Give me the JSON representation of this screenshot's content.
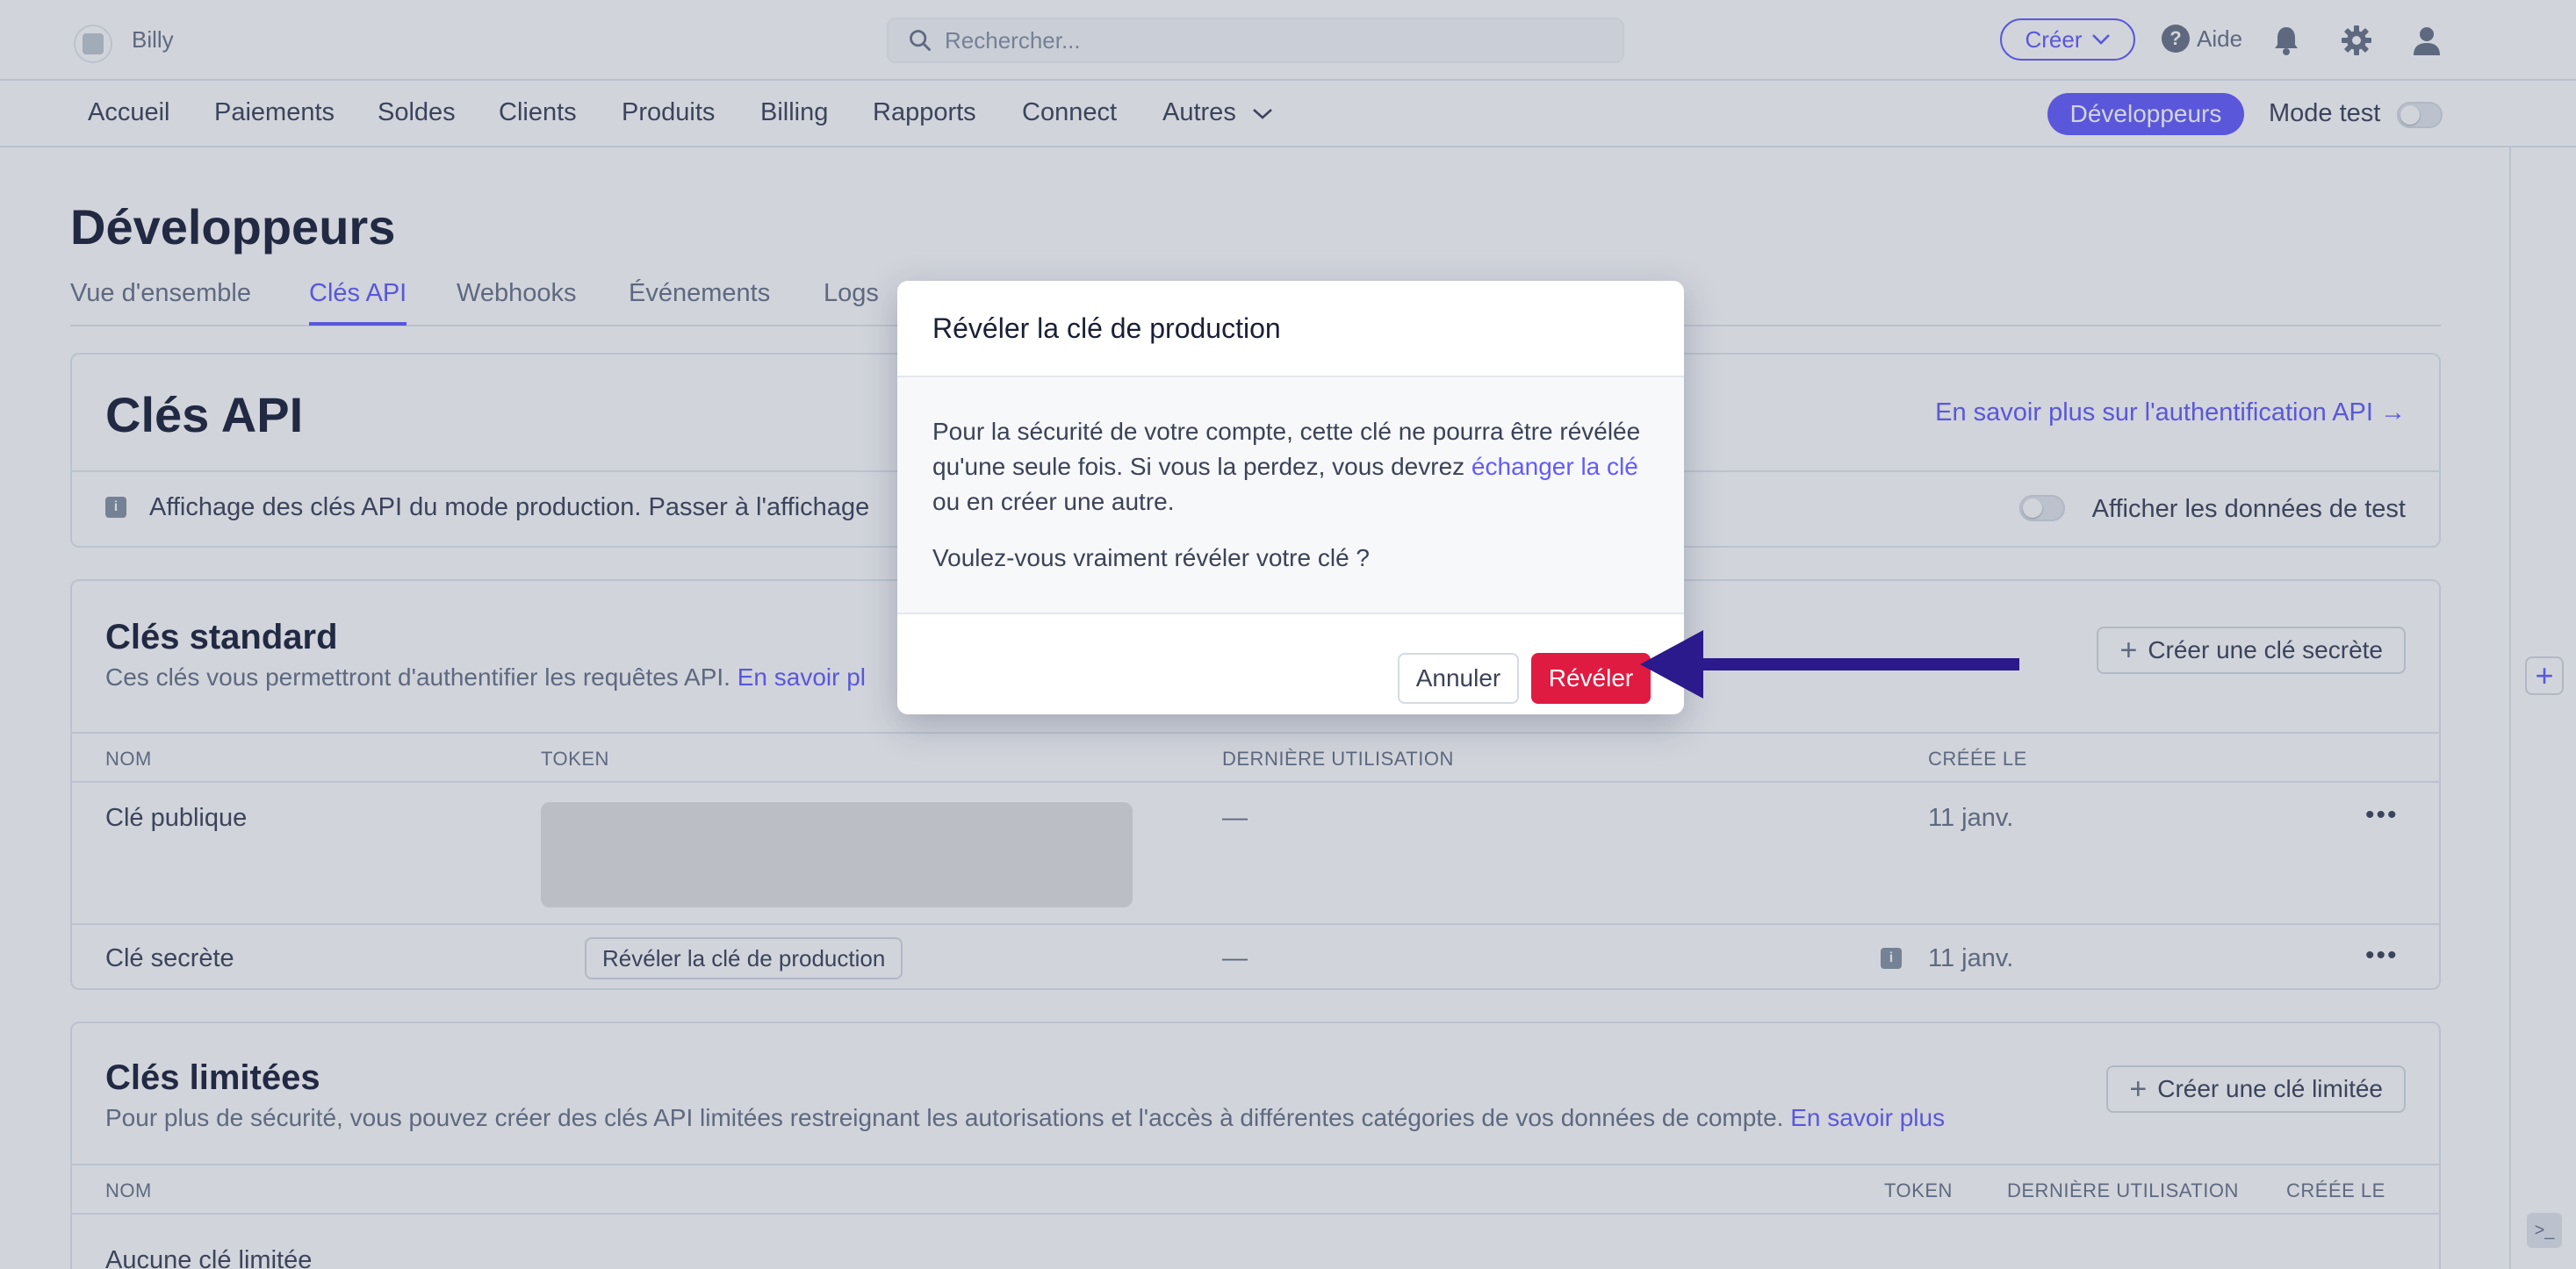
{
  "topbar": {
    "account_name": "Billy",
    "search_placeholder": "Rechercher...",
    "create_label": "Créer",
    "help_label": "Aide"
  },
  "nav": {
    "items": [
      "Accueil",
      "Paiements",
      "Soldes",
      "Clients",
      "Produits",
      "Billing",
      "Rapports",
      "Connect",
      "Autres"
    ],
    "developers_label": "Développeurs",
    "test_mode_label": "Mode test",
    "test_mode_on": false
  },
  "page": {
    "title": "Développeurs",
    "tabs": [
      "Vue d'ensemble",
      "Clés API",
      "Webhooks",
      "Événements",
      "Logs"
    ],
    "active_tab": "Clés API"
  },
  "api_keys_card": {
    "heading": "Clés API",
    "learn_link": "En savoir plus sur l'authentification API →",
    "info_text": "Affichage des clés API du mode production. Passer à l'affichage",
    "show_test_label": "Afficher les données de test"
  },
  "standard_keys": {
    "heading": "Clés standard",
    "subtitle": "Ces clés vous permettront d'authentifier les requêtes API.",
    "subtitle_link": "En savoir pl",
    "create_button": "Créer une clé secrète",
    "columns": [
      "NOM",
      "TOKEN",
      "DERNIÈRE UTILISATION",
      "CRÉÉE LE"
    ],
    "rows": [
      {
        "name": "Clé publique",
        "last_used": "—",
        "created": "11 janv.",
        "more": "•••"
      },
      {
        "name": "Clé secrète",
        "token_button": "Révéler la clé de production",
        "last_used": "—",
        "created": "11 janv.",
        "more": "•••"
      }
    ]
  },
  "restricted_keys": {
    "heading": "Clés limitées",
    "subtitle": "Pour plus de sécurité, vous pouvez créer des clés API limitées restreignant les autorisations et l'accès à différentes catégories de vos données de compte.",
    "subtitle_link": "En savoir plus",
    "create_button": "Créer une clé limitée",
    "columns": [
      "NOM",
      "TOKEN",
      "DERNIÈRE UTILISATION",
      "CRÉÉE LE"
    ],
    "empty_text": "Aucune clé limitée"
  },
  "modal": {
    "title": "Révéler la clé de production",
    "body_part1": "Pour la sécurité de votre compte, cette clé ne pourra être révélée qu'une seule fois. Si vous la perdez, vous devrez ",
    "body_link": "échanger la clé",
    "body_part2": " ou en créer une autre.",
    "question": "Voulez-vous vraiment révéler votre clé ?",
    "cancel_label": "Annuler",
    "confirm_label": "Révéler"
  },
  "annotation": {
    "arrow_color": "#2a1a8c"
  },
  "colors": {
    "accent": "#635bff",
    "danger": "#df1b41",
    "text": "#1a1f36",
    "muted": "#697386"
  }
}
